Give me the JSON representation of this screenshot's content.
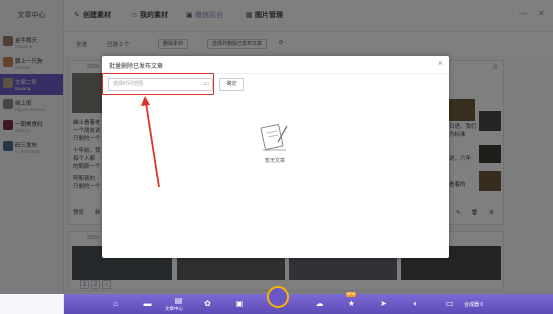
{
  "sidebar": {
    "title": "文章中心",
    "accounts": [
      {
        "name": "金牛旗天",
        "sub": "Zhiqiang",
        "active": false
      },
      {
        "name": "朝上一只狗",
        "sub": "yuti018",
        "active": false
      },
      {
        "name": "文案二阶",
        "sub": "Buyang",
        "active": true
      },
      {
        "name": "绒上雨",
        "sub": "Pigeon Review",
        "active": false
      },
      {
        "name": "一朝美食码",
        "sub": "yibaryu",
        "active": false
      },
      {
        "name": "码三发布",
        "sub": "yi_95474436",
        "active": false
      }
    ]
  },
  "tabs": [
    {
      "icon": "✎",
      "label": "创建素材"
    },
    {
      "icon": "☺",
      "label": "我的素材"
    },
    {
      "icon": "▣",
      "label": "微信后台"
    },
    {
      "icon": "▦",
      "label": "图片管理"
    }
  ],
  "toolbar": {
    "select_all": "全选",
    "selected": "已选 0 个",
    "delete_btn": "删除素材",
    "batch_delete_btn": "选择并删除已发布文章"
  },
  "background": {
    "dates": [
      "2020",
      "2020"
    ],
    "snippets": [
      "幽士看着老",
      "一个朋友说",
      "只剩的一个",
      "十年前，我",
      "每个人都",
      "的朝颜一个",
      "阿斯顿的",
      "只剩的一个",
      "预览",
      "新"
    ],
    "right_snippets": [
      "2021",
      "日语，我们",
      "为标准",
      "说，六年",
      "看着的"
    ]
  },
  "modal": {
    "title": "批量删除已发布文章",
    "close": "×",
    "date_placeholder": "选择时间范围",
    "confirm": "确定",
    "empty_text": "暂无文章"
  },
  "pager": [
    "1",
    "2",
    "›"
  ],
  "dock": {
    "icons": [
      "home-icon",
      "monitor-icon",
      "article-icon",
      "gift-icon",
      "wallet-icon",
      "chat-icon",
      "star-icon",
      "send-icon",
      "share-icon",
      "display-icon"
    ],
    "article_label": "文章中心",
    "badge": "NEW",
    "compose_label": "合成器",
    "compose_count": "0"
  },
  "colors": {
    "accent": "#6f5dc6",
    "annotation": "#e0312b",
    "dock_center_ring": "#f5b500"
  }
}
